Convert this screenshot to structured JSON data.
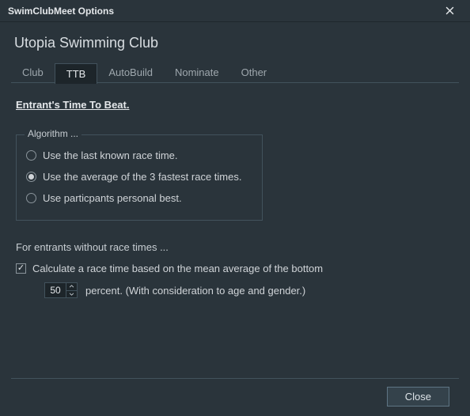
{
  "window": {
    "title": "SwimClubMeet Options"
  },
  "clubName": "Utopia Swimming Club",
  "tabs": [
    {
      "label": "Club"
    },
    {
      "label": "TTB"
    },
    {
      "label": "AutoBuild"
    },
    {
      "label": "Nominate"
    },
    {
      "label": "Other"
    }
  ],
  "ttb": {
    "heading": "Entrant's Time To Beat.",
    "algorithm": {
      "legend": "Algorithm ...",
      "options": [
        "Use the last known race time.",
        "Use the average of the 3 fastest race times.",
        "Use particpants personal best."
      ],
      "selectedIndex": 1
    },
    "noTimes": {
      "heading": "For entrants without race times ...",
      "checkLabel": "Calculate a race time based on the mean average of the bottom",
      "checked": true,
      "percentValue": "50",
      "percentSuffix": "percent. (With consideration to age and gender.)"
    }
  },
  "footer": {
    "close": "Close"
  }
}
